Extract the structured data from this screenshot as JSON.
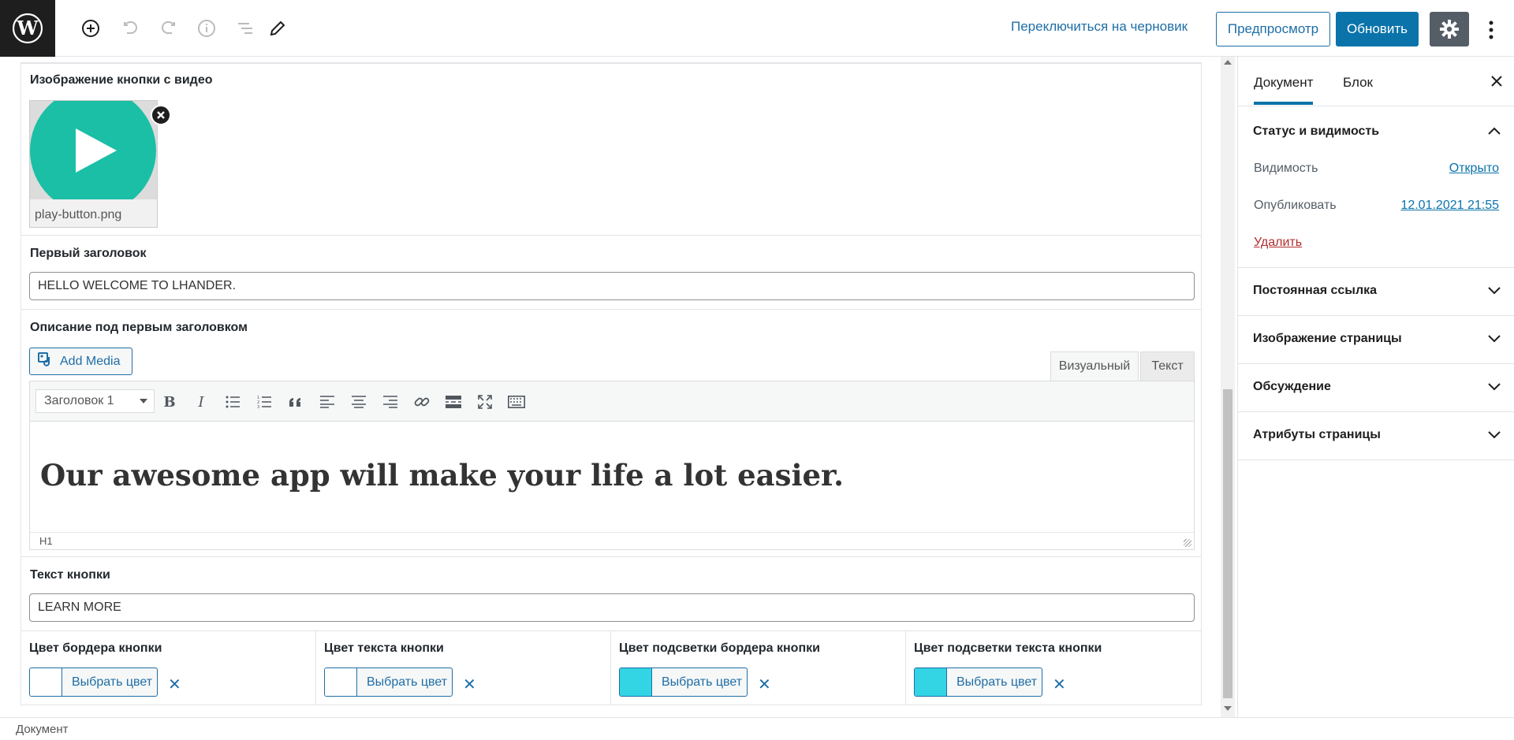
{
  "toolbar": {
    "switch_to_draft": "Переключиться на черновик",
    "preview": "Предпросмотр",
    "update": "Обновить"
  },
  "fields": {
    "video_button_image": {
      "label": "Изображение кнопки с видео",
      "filename": "play-button.png"
    },
    "first_heading": {
      "label": "Первый заголовок",
      "value": "HELLO WELCOME TO LHANDER."
    },
    "first_heading_description": {
      "label": "Описание под первым заголовком",
      "add_media": "Add Media",
      "tab_visual": "Визуальный",
      "tab_text": "Текст",
      "format_select": "Заголовок 1",
      "content": "Our awesome app will make your life a lot easier.",
      "status_path": "H1"
    },
    "button_text": {
      "label": "Текст кнопки",
      "value": "LEARN MORE"
    },
    "colors": [
      {
        "label": "Цвет бордера кнопки",
        "button": "Выбрать цвет",
        "swatch": "#ffffff"
      },
      {
        "label": "Цвет текста кнопки",
        "button": "Выбрать цвет",
        "swatch": "#ffffff"
      },
      {
        "label": "Цвет подсветки бордера кнопки",
        "button": "Выбрать цвет",
        "swatch": "#33d5e5"
      },
      {
        "label": "Цвет подсветки текста кнопки",
        "button": "Выбрать цвет",
        "swatch": "#33d5e5"
      }
    ]
  },
  "sidebar": {
    "tabs": [
      "Документ",
      "Блок"
    ],
    "status": {
      "title": "Статус и видимость",
      "visibility_label": "Видимость",
      "visibility_value": "Открыто",
      "publish_label": "Опубликовать",
      "publish_value": "12.01.2021 21:55",
      "delete": "Удалить"
    },
    "sections": [
      "Постоянная ссылка",
      "Изображение страницы",
      "Обсуждение",
      "Атрибуты страницы"
    ]
  },
  "footer": {
    "breadcrumb": "Документ"
  },
  "colors": {
    "accent": "#0a73aa",
    "play_teal": "#1bbfa6",
    "swatch_cyan": "#33d5e5"
  }
}
